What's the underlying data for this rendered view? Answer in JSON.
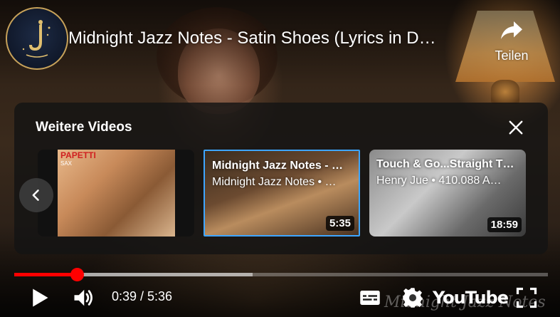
{
  "video": {
    "title": "Midnight Jazz Notes - Satin Shoes (Lyrics in D…",
    "watermark": "Midnight Jazz Notes"
  },
  "channel": {
    "avatar_icon": "saxophone-moon-logo"
  },
  "share": {
    "label": "Teilen",
    "icon": "share-arrow-icon"
  },
  "more_videos": {
    "title": "Weitere Videos",
    "items": [
      {
        "title": "",
        "meta": "",
        "duration": "",
        "thumb_text_1": "PAPETTI",
        "thumb_text_2": "SAX"
      },
      {
        "title": "Midnight Jazz Notes - …",
        "meta": "Midnight Jazz Notes • …",
        "duration": "5:35"
      },
      {
        "title": "Touch & Go...Straight T…",
        "meta": "Henry Jue • 410.088 A…",
        "duration": "18:59"
      }
    ]
  },
  "player": {
    "current_time": "0:39",
    "duration": "5:36",
    "time_display": "0:39 / 5:36",
    "progress_fraction": 0.117,
    "buffered_fraction": 0.447,
    "logo_text": "YouTube",
    "colors": {
      "progress": "#ff0000",
      "selected_border": "#3ea6ff"
    }
  }
}
